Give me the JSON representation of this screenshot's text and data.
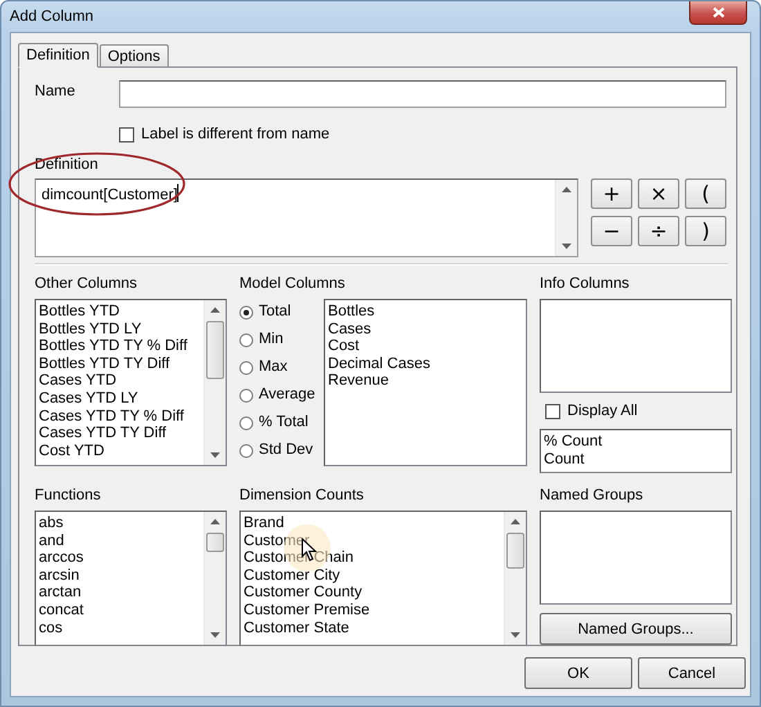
{
  "window": {
    "title": "Add Column"
  },
  "tabs": [
    {
      "label": "Definition",
      "selected": true
    },
    {
      "label": "Options",
      "selected": false
    }
  ],
  "name": {
    "label": "Name"
  },
  "label_differs": {
    "label": "Label is different from name",
    "checked": false
  },
  "definition": {
    "label": "Definition",
    "value": "dimcount[Customer]"
  },
  "operators": [
    "+",
    "×",
    "(",
    "−",
    "÷",
    ")"
  ],
  "other_columns": {
    "label": "Other Columns",
    "items": [
      "Bottles YTD",
      "Bottles YTD LY",
      "Bottles YTD TY % Diff",
      "Bottles YTD TY Diff",
      "Cases YTD",
      "Cases YTD LY",
      "Cases YTD TY % Diff",
      "Cases YTD TY Diff",
      "Cost YTD"
    ]
  },
  "model_columns": {
    "label": "Model Columns",
    "aggregates": [
      {
        "label": "Total",
        "selected": true
      },
      {
        "label": "Min",
        "selected": false
      },
      {
        "label": "Max",
        "selected": false
      },
      {
        "label": "Average",
        "selected": false
      },
      {
        "label": "% Total",
        "selected": false
      },
      {
        "label": "Std Dev",
        "selected": false
      }
    ],
    "items": [
      "Bottles",
      "Cases",
      "Cost",
      "Decimal Cases",
      "Revenue"
    ]
  },
  "info_columns": {
    "label": "Info Columns",
    "display_all": {
      "label": "Display All",
      "checked": false
    },
    "items": [
      "% Count",
      "Count"
    ]
  },
  "functions": {
    "label": "Functions",
    "items": [
      "abs",
      "and",
      "arccos",
      "arcsin",
      "arctan",
      "concat",
      "cos"
    ]
  },
  "dimension_counts": {
    "label": "Dimension Counts",
    "items": [
      "Brand",
      "Customer",
      "Customer Chain",
      "Customer City",
      "Customer County",
      "Customer Premise",
      "Customer State"
    ]
  },
  "named_groups": {
    "label": "Named Groups",
    "button": "Named Groups..."
  },
  "buttons": [
    "OK",
    "Cancel"
  ]
}
